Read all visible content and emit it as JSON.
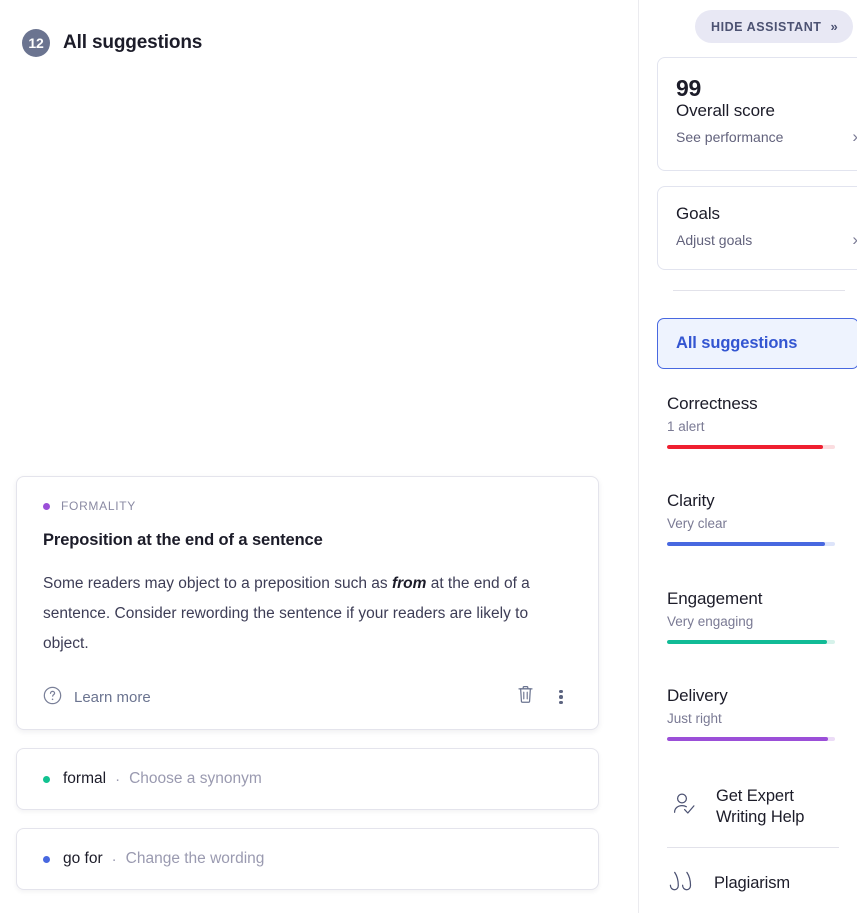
{
  "main": {
    "badge_count": "12",
    "title": "All suggestions",
    "suggestion_card": {
      "category": "FORMALITY",
      "category_dot_color": "#9b4fd8",
      "title": "Preposition at the end of a sentence",
      "body_before": "Some readers may object to a preposition such as ",
      "body_emphasis": "from",
      "body_after": " at the end of a sentence. Consider rewording the sentence if your readers are likely to object.",
      "learn_more": "Learn more",
      "help_icon": "question-circle-icon",
      "delete_icon": "trash-icon",
      "more_icon": "more-vertical-icon"
    },
    "chips": [
      {
        "dot_color": "#11c290",
        "word": "formal",
        "separator": "·",
        "action": "Choose a synonym"
      },
      {
        "dot_color": "#4868e0",
        "word": "go for",
        "separator": "·",
        "action": "Change the wording"
      }
    ]
  },
  "sidebar": {
    "hide_assistant": {
      "label": "HIDE ASSISTANT",
      "chevron": "»"
    },
    "score_card": {
      "score": "99",
      "label": "Overall score",
      "link": "See performance",
      "chevron": "›"
    },
    "goals_card": {
      "title": "Goals",
      "link": "Adjust goals",
      "chevron": "›"
    },
    "tab_all_suggestions": "All suggestions",
    "metrics": [
      {
        "name": "Correctness",
        "status": "1 alert",
        "color": "#ef1f30",
        "track": "#fbdde0",
        "percent": 93
      },
      {
        "name": "Clarity",
        "status": "Very clear",
        "color": "#4868e0",
        "track": "#dde4fa",
        "percent": 94
      },
      {
        "name": "Engagement",
        "status": "Very engaging",
        "color": "#11bb96",
        "track": "#d6f2ea",
        "percent": 95
      },
      {
        "name": "Delivery",
        "status": "Just right",
        "color": "#9b4fd8",
        "track": "#ecdcf7",
        "percent": 96
      }
    ],
    "actions": [
      {
        "icon": "person-check-icon",
        "label_line1": "Get Expert",
        "label_line2": "Writing Help"
      },
      {
        "icon": "quote-icon",
        "label_line1": "Plagiarism",
        "label_line2": ""
      }
    ]
  }
}
